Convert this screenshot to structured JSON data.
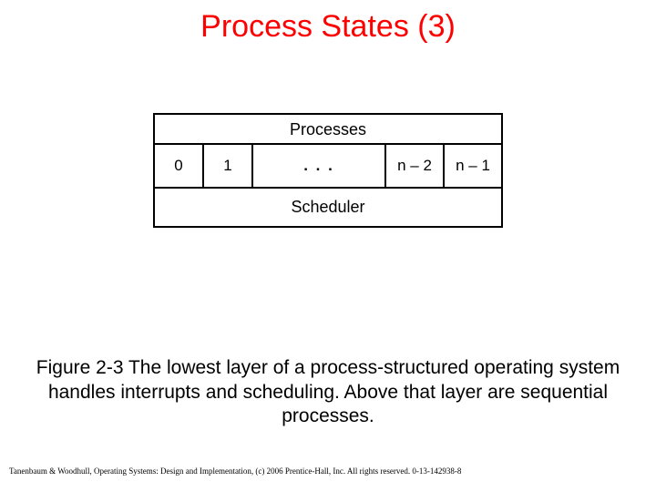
{
  "title": "Process States (3)",
  "diagram": {
    "header": "Processes",
    "slot0": "0",
    "slot1": "1",
    "dots": ". . .",
    "slot_n2": "n – 2",
    "slot_n1": "n – 1",
    "scheduler": "Scheduler"
  },
  "caption": "Figure 2-3 The lowest layer of a process-structured operating system handles interrupts and scheduling. Above that layer are sequential processes.",
  "footer": "Tanenbaum & Woodhull, Operating Systems: Design and Implementation, (c) 2006 Prentice-Hall, Inc. All rights reserved. 0-13-142938-8"
}
